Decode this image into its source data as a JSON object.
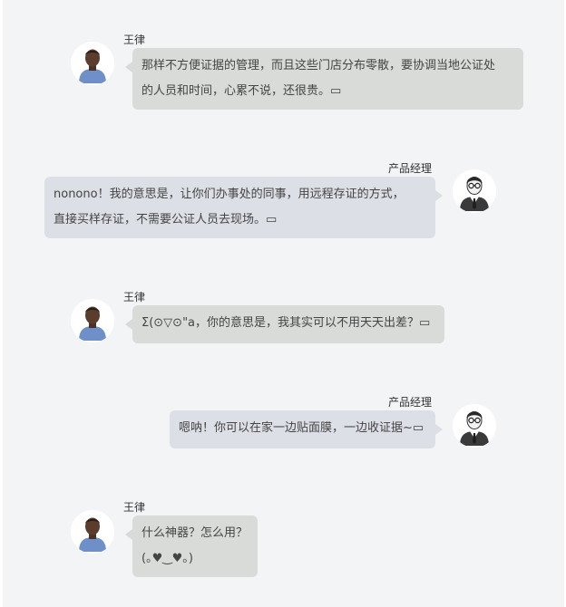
{
  "participants": {
    "user_name": "王律",
    "pm_name": "产品经理"
  },
  "messages": [
    {
      "sender": "王律",
      "text": "那样不方便证据的管理，而且这些门店分布零散，要协调当地公证处\n的人员和时间，心累不说，还很贵。▭"
    },
    {
      "sender": "产品经理",
      "text": "nonono！我的意思是，让你们办事处的同事，用远程存证的方式，\n直接买样存证，不需要公证人员去现场。▭"
    },
    {
      "sender": "王律",
      "text": "Σ(⊙▽⊙\"a，你的意思是，我其实可以不用天天出差？▭"
    },
    {
      "sender": "产品经理",
      "text": "嗯呐！你可以在家一边贴面膜，一边收证据~▭"
    },
    {
      "sender": "王律",
      "text": "什么神器？怎么用？\n(｡♥‿♥｡)"
    }
  ],
  "avatars": {
    "user": "man-avatar-icon",
    "pm": "businessman-glasses-avatar-icon"
  },
  "colors": {
    "background": "#f3f4f6",
    "user_bubble": "#d8dbd8",
    "pm_bubble": "#dcdfe6"
  }
}
